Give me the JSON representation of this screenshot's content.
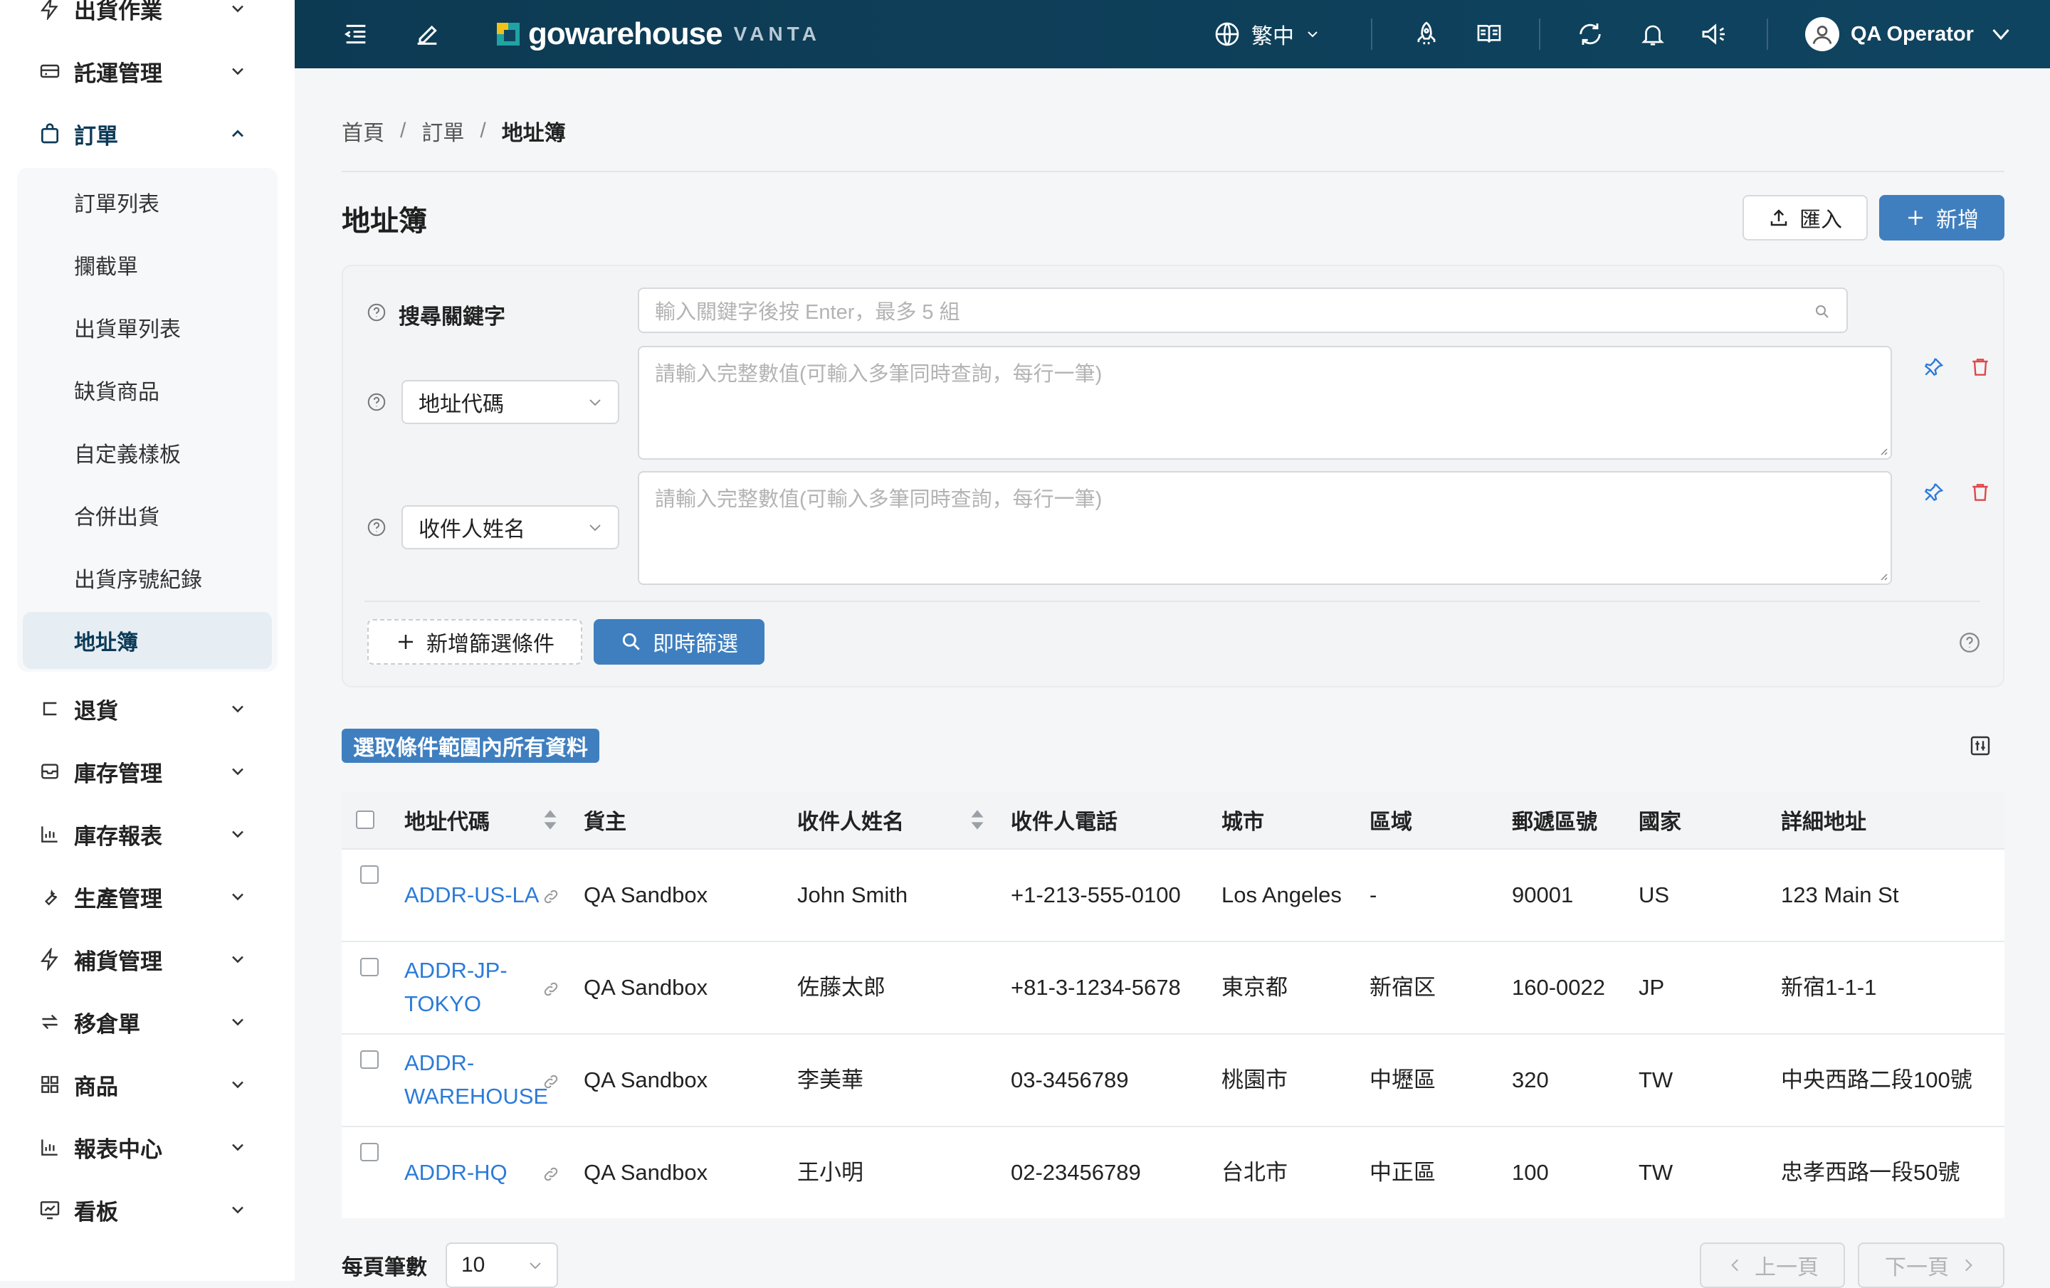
{
  "sidebar": {
    "items": [
      {
        "label": "出貨作業"
      },
      {
        "label": "託運管理"
      },
      {
        "label": "訂單"
      },
      {
        "label": "退貨"
      },
      {
        "label": "庫存管理"
      },
      {
        "label": "庫存報表"
      },
      {
        "label": "生產管理"
      },
      {
        "label": "補貨管理"
      },
      {
        "label": "移倉單"
      },
      {
        "label": "商品"
      },
      {
        "label": "報表中心"
      },
      {
        "label": "看板"
      }
    ],
    "submenu": [
      {
        "label": "訂單列表"
      },
      {
        "label": "攔截單"
      },
      {
        "label": "出貨單列表"
      },
      {
        "label": "缺貨商品"
      },
      {
        "label": "自定義樣板"
      },
      {
        "label": "合併出貨"
      },
      {
        "label": "出貨序號紀錄"
      },
      {
        "label": "地址簿",
        "active": true
      }
    ]
  },
  "header": {
    "logo_text": "gowarehouse",
    "logo_sub": "VANTA",
    "language": "繁中",
    "user_name": "QA Operator",
    "colors": {
      "bar": "#0f4460",
      "accent": "#3f7fbf",
      "link": "#2b7bd8"
    }
  },
  "breadcrumb": [
    "首頁",
    "訂單",
    "地址簿"
  ],
  "page": {
    "title": "地址簿",
    "import_label": "匯入",
    "add_label": "新增"
  },
  "filter": {
    "keyword_label": "搜尋關鍵字",
    "keyword_placeholder": "輸入關鍵字後按 Enter，最多 5 組",
    "rows": [
      {
        "field": "地址代碼",
        "placeholder": "請輸入完整數值(可輸入多筆同時查詢，每行一筆)"
      },
      {
        "field": "收件人姓名",
        "placeholder": "請輸入完整數值(可輸入多筆同時查詢，每行一筆)"
      }
    ],
    "add_filter_label": "新增篩選條件",
    "apply_label": "即時篩選"
  },
  "table": {
    "select_all_label": "選取條件範圍內所有資料",
    "columns": [
      "地址代碼",
      "貨主",
      "收件人姓名",
      "收件人電話",
      "城市",
      "區域",
      "郵遞區號",
      "國家",
      "詳細地址"
    ],
    "rows": [
      {
        "code_lines": [
          "ADDR-US-LA"
        ],
        "owner": "QA Sandbox",
        "name": "John Smith",
        "phone": "+1-213-555-0100",
        "city": "Los Angeles",
        "district": "-",
        "zip": "90001",
        "country": "US",
        "address": "123 Main St"
      },
      {
        "code_lines": [
          "ADDR-JP-",
          "TOKYO"
        ],
        "owner": "QA Sandbox",
        "name": "佐藤太郎",
        "phone": "+81-3-1234-5678",
        "city": "東京都",
        "district": "新宿区",
        "zip": "160-0022",
        "country": "JP",
        "address": "新宿1-1-1"
      },
      {
        "code_lines": [
          "ADDR-",
          "WAREHOUSE"
        ],
        "owner": "QA Sandbox",
        "name": "李美華",
        "phone": "03-3456789",
        "city": "桃園市",
        "district": "中壢區",
        "zip": "320",
        "country": "TW",
        "address": "中央西路二段100號"
      },
      {
        "code_lines": [
          "ADDR-HQ"
        ],
        "owner": "QA Sandbox",
        "name": "王小明",
        "phone": "02-23456789",
        "city": "台北市",
        "district": "中正區",
        "zip": "100",
        "country": "TW",
        "address": "忠孝西路一段50號"
      }
    ]
  },
  "pagination": {
    "page_size_label": "每頁筆數",
    "page_size": "10",
    "prev_label": "上一頁",
    "next_label": "下一頁"
  }
}
